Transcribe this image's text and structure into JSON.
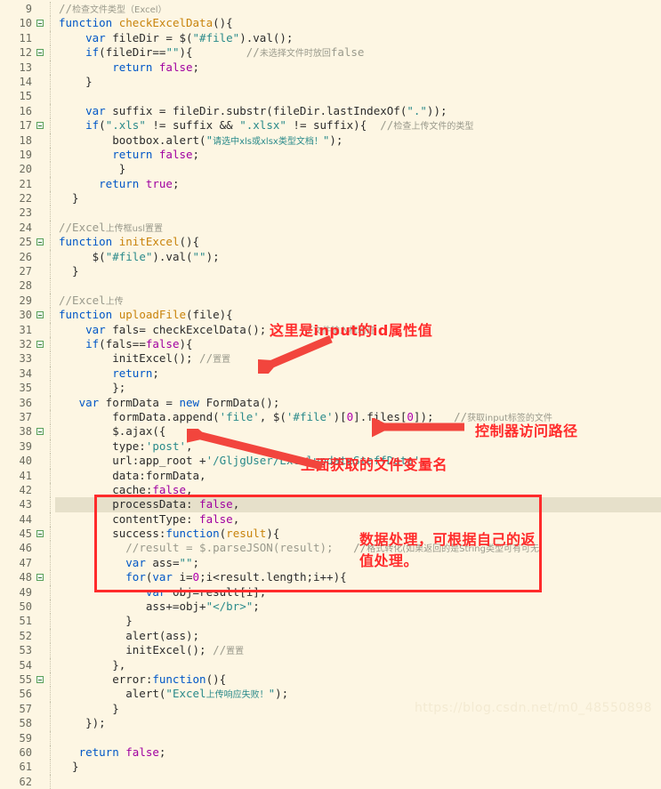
{
  "editor": {
    "theme_background": "#fdf6e3",
    "highlighted_line": 43,
    "watermark": "https://blog.csdn.net/m0_48550898",
    "first_line_number": 9,
    "lines": [
      {
        "n": "9",
        "fold": false,
        "indent": 2,
        "html": "<span class=\"cm\">//</span><span class=\"cmz\">检查文件类型（Excel）</span>"
      },
      {
        "n": "10",
        "fold": true,
        "indent": 2,
        "html": "<span class=\"kw\">function</span> <span class=\"fn\">checkExcelData</span>(){"
      },
      {
        "n": "11",
        "fold": false,
        "indent": 3,
        "html": "    <span class=\"kw\">var</span> fileDir = $(<span class=\"str\">\"#file\"</span>).val();"
      },
      {
        "n": "12",
        "fold": true,
        "indent": 3,
        "html": "    <span class=\"kw\">if</span>(fileDir==<span class=\"str\">\"\"</span>){        <span class=\"cm\">//</span><span class=\"cmz\">未选择文件时放回</span><span class=\"cm\">false</span>"
      },
      {
        "n": "13",
        "fold": false,
        "indent": 4,
        "html": "        <span class=\"kw\">return</span> <span class=\"bool\">false</span>;"
      },
      {
        "n": "14",
        "fold": false,
        "indent": 3,
        "html": "    }"
      },
      {
        "n": "15",
        "fold": false,
        "indent": 0,
        "html": ""
      },
      {
        "n": "16",
        "fold": false,
        "indent": 3,
        "html": "    <span class=\"kw\">var</span> suffix = fileDir.substr(fileDir.lastIndexOf(<span class=\"str\">\".\"</span>));"
      },
      {
        "n": "17",
        "fold": true,
        "indent": 3,
        "html": "    <span class=\"kw\">if</span>(<span class=\"str\">\".xls\"</span> != suffix &amp;&amp; <span class=\"str\">\".xlsx\"</span> != suffix){  <span class=\"cm\">//</span><span class=\"cmz\">检查上传文件的类型</span>"
      },
      {
        "n": "18",
        "fold": false,
        "indent": 4,
        "html": "        bootbox.alert(<span class=\"str\">\"</span><span class=\"str cmz\" style=\"color:#2a8a8a\">请选中xls或xlsx类型文档！</span><span class=\"str\">\"</span>);"
      },
      {
        "n": "19",
        "fold": false,
        "indent": 4,
        "html": "        <span class=\"kw\">return</span> <span class=\"bool\">false</span>;"
      },
      {
        "n": "20",
        "fold": false,
        "indent": 4,
        "html": "         }"
      },
      {
        "n": "21",
        "fold": false,
        "indent": 3,
        "html": "      <span class=\"kw\">return</span> <span class=\"bool\">true</span>;"
      },
      {
        "n": "22",
        "fold": false,
        "indent": 2,
        "html": "  }"
      },
      {
        "n": "23",
        "fold": false,
        "indent": 0,
        "html": ""
      },
      {
        "n": "24",
        "fold": false,
        "indent": 2,
        "html": "<span class=\"cm\">//Excel</span><span class=\"cmz\">上传框usl置置</span>"
      },
      {
        "n": "25",
        "fold": true,
        "indent": 2,
        "html": "<span class=\"kw\">function</span> <span class=\"fn\">initExcel</span>(){"
      },
      {
        "n": "26",
        "fold": false,
        "indent": 3,
        "html": "     $(<span class=\"str\">\"#file\"</span>).val(<span class=\"str\">\"\"</span>);"
      },
      {
        "n": "27",
        "fold": false,
        "indent": 2,
        "html": "  }"
      },
      {
        "n": "28",
        "fold": false,
        "indent": 0,
        "html": ""
      },
      {
        "n": "29",
        "fold": false,
        "indent": 2,
        "html": "<span class=\"cm\">//Excel</span><span class=\"cmz\">上传</span>"
      },
      {
        "n": "30",
        "fold": true,
        "indent": 2,
        "html": "<span class=\"kw\">function</span> <span class=\"fn\">uploadFile</span>(file){"
      },
      {
        "n": "31",
        "fold": false,
        "indent": 3,
        "html": "    <span class=\"kw\">var</span> fals= checkExcelData();     <span class=\"cm\">//</span><span class=\"cmz\">文件输入框验证</span>"
      },
      {
        "n": "32",
        "fold": true,
        "indent": 3,
        "html": "    <span class=\"kw\">if</span>(fals==<span class=\"bool\">false</span>){"
      },
      {
        "n": "33",
        "fold": false,
        "indent": 4,
        "html": "        initExcel(); <span class=\"cm\">//</span><span class=\"cmz\">置置</span>"
      },
      {
        "n": "34",
        "fold": false,
        "indent": 4,
        "html": "        <span class=\"kw\">return</span>;"
      },
      {
        "n": "35",
        "fold": false,
        "indent": 4,
        "html": "        };"
      },
      {
        "n": "36",
        "fold": false,
        "indent": 3,
        "html": "   <span class=\"kw\">var</span> formData = <span class=\"kw\">new</span> FormData();"
      },
      {
        "n": "37",
        "fold": false,
        "indent": 4,
        "html": "        formData.append(<span class=\"str\">'file'</span>, $(<span class=\"str\">'#file'</span>)[<span class=\"num\">0</span>].files[<span class=\"num\">0</span>]);   <span class=\"cm\">//</span><span class=\"cmz\">获取input标签的文件</span>"
      },
      {
        "n": "38",
        "fold": true,
        "indent": 4,
        "html": "        $.ajax({"
      },
      {
        "n": "39",
        "fold": false,
        "indent": 4,
        "html": "        type:<span class=\"str\">'post'</span>,"
      },
      {
        "n": "40",
        "fold": false,
        "indent": 4,
        "html": "        url:app_root +<span class=\"str\">'/GljgUser/ExcelupdateStaffData'</span>,"
      },
      {
        "n": "41",
        "fold": false,
        "indent": 4,
        "html": "        data:formData,"
      },
      {
        "n": "42",
        "fold": false,
        "indent": 4,
        "html": "        cache:<span class=\"bool\">false</span>,"
      },
      {
        "n": "43",
        "fold": false,
        "indent": 4,
        "html": "        processData: <span class=\"bool\">false</span>,"
      },
      {
        "n": "44",
        "fold": false,
        "indent": 4,
        "html": "        contentType: <span class=\"bool\">false</span>,"
      },
      {
        "n": "45",
        "fold": true,
        "indent": 4,
        "html": "        success:<span class=\"kw\">function</span>(<span class=\"fn\">result</span>){"
      },
      {
        "n": "46",
        "fold": false,
        "indent": 5,
        "html": "          <span class=\"cm\">//result = $.parseJSON(result);   //</span><span class=\"cmz\">格式转化(如果返回的是String类型可有可无)</span>"
      },
      {
        "n": "47",
        "fold": false,
        "indent": 5,
        "html": "          <span class=\"kw\">var</span> ass=<span class=\"str\">\"\"</span>;"
      },
      {
        "n": "48",
        "fold": true,
        "indent": 5,
        "html": "          <span class=\"kw\">for</span>(<span class=\"kw\">var</span> i=<span class=\"num\">0</span>;i&lt;result.length;i++){"
      },
      {
        "n": "49",
        "fold": false,
        "indent": 6,
        "html": "             <span class=\"kw\">var</span> obj=result[i];"
      },
      {
        "n": "50",
        "fold": false,
        "indent": 6,
        "html": "             ass+=obj+<span class=\"str\">\"&lt;/br&gt;\"</span>;"
      },
      {
        "n": "51",
        "fold": false,
        "indent": 5,
        "html": "          }"
      },
      {
        "n": "52",
        "fold": false,
        "indent": 5,
        "html": "          alert(ass);"
      },
      {
        "n": "53",
        "fold": false,
        "indent": 5,
        "html": "          initExcel(); <span class=\"cm\">//</span><span class=\"cmz\">置置</span>"
      },
      {
        "n": "54",
        "fold": false,
        "indent": 4,
        "html": "        },"
      },
      {
        "n": "55",
        "fold": true,
        "indent": 4,
        "html": "        error:<span class=\"kw\">function</span>(){"
      },
      {
        "n": "56",
        "fold": false,
        "indent": 5,
        "html": "          alert(<span class=\"str\">\"Excel</span><span class=\"str cmz\" style=\"color:#2a8a8a\">上传响应失败！</span><span class=\"str\">\"</span>);"
      },
      {
        "n": "57",
        "fold": false,
        "indent": 4,
        "html": "        }"
      },
      {
        "n": "58",
        "fold": false,
        "indent": 3,
        "html": "    });"
      },
      {
        "n": "59",
        "fold": false,
        "indent": 0,
        "html": ""
      },
      {
        "n": "60",
        "fold": false,
        "indent": 2,
        "html": "   <span class=\"kw\">return</span> <span class=\"bool\">false</span>;"
      },
      {
        "n": "61",
        "fold": false,
        "indent": 2,
        "html": "  }"
      },
      {
        "n": "62",
        "fold": false,
        "indent": 0,
        "html": ""
      }
    ]
  },
  "annotations": {
    "color": "#ff2b2b",
    "items": [
      {
        "id": "anno1",
        "text": "这里是input的id属性值"
      },
      {
        "id": "anno2",
        "text": "控制器访问路径"
      },
      {
        "id": "anno3",
        "text": "上面获取的文件变量名"
      },
      {
        "id": "anno4",
        "text": "数据处理，可根据自己的返值处理。"
      }
    ],
    "arrows": 3,
    "boxes": 1
  }
}
